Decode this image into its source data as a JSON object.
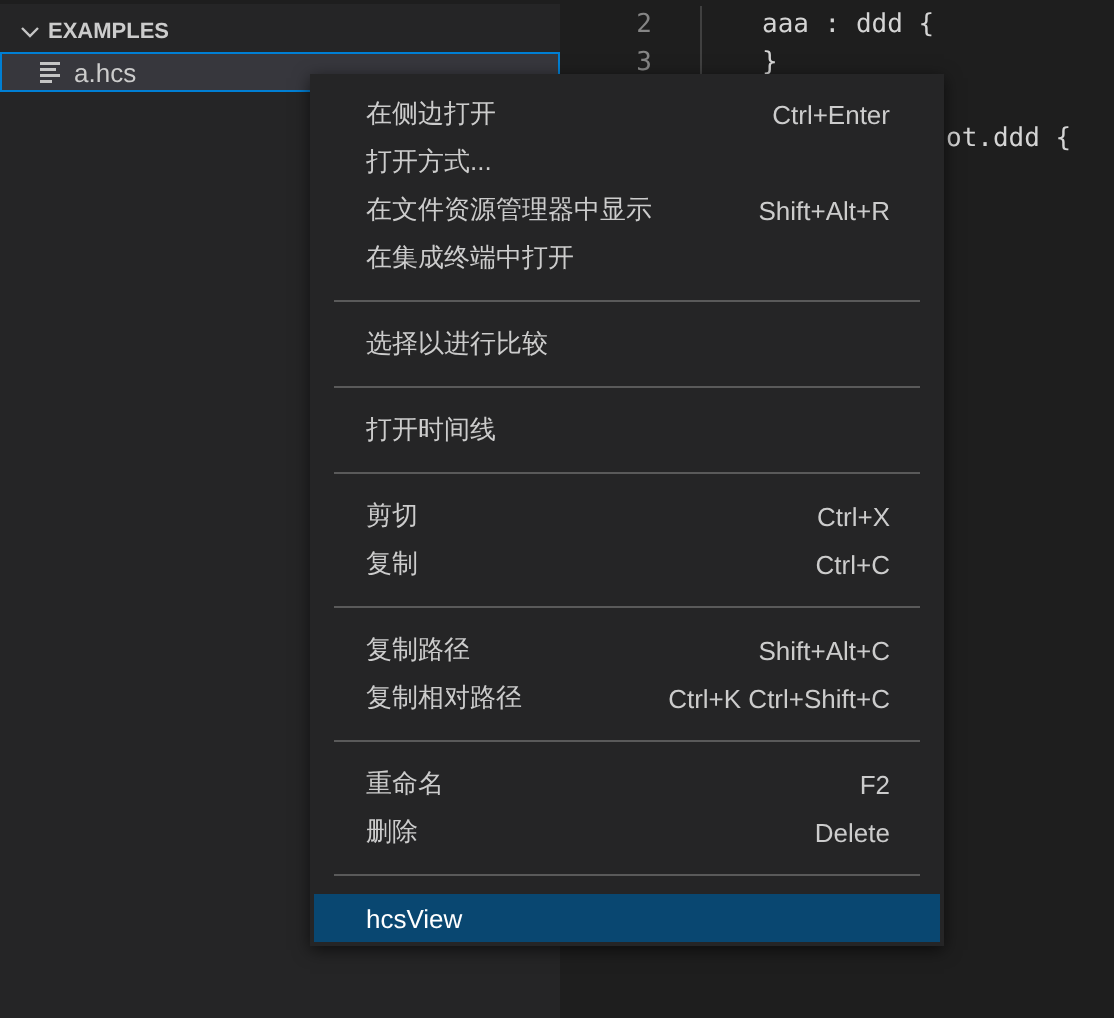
{
  "explorer": {
    "section": "EXAMPLES",
    "expanded": true,
    "files": [
      {
        "name": "a.hcs",
        "selected": true
      }
    ]
  },
  "editor": {
    "lines": [
      {
        "number": "2",
        "text": "aaa : ddd {"
      },
      {
        "number": "3",
        "text": "}"
      }
    ],
    "partial_line": "ot.ddd {"
  },
  "context_menu": {
    "groups": [
      [
        {
          "label": "在侧边打开",
          "shortcut": "Ctrl+Enter",
          "selected": false
        },
        {
          "label": "打开方式...",
          "selected": false
        },
        {
          "label": "在文件资源管理器中显示",
          "shortcut": "Shift+Alt+R",
          "selected": false
        },
        {
          "label": "在集成终端中打开",
          "selected": false
        }
      ],
      [
        {
          "label": "选择以进行比较",
          "selected": false
        }
      ],
      [
        {
          "label": "打开时间线",
          "selected": false
        }
      ],
      [
        {
          "label": "剪切",
          "shortcut": "Ctrl+X",
          "selected": false
        },
        {
          "label": "复制",
          "shortcut": "Ctrl+C",
          "selected": false
        }
      ],
      [
        {
          "label": "复制路径",
          "shortcut": "Shift+Alt+C",
          "selected": false
        },
        {
          "label": "复制相对路径",
          "shortcut": "Ctrl+K Ctrl+Shift+C",
          "selected": false
        }
      ],
      [
        {
          "label": "重命名",
          "shortcut": "F2",
          "selected": false
        },
        {
          "label": "删除",
          "shortcut": "Delete",
          "selected": false
        }
      ],
      [
        {
          "label": "hcsView",
          "selected": true
        }
      ]
    ]
  }
}
